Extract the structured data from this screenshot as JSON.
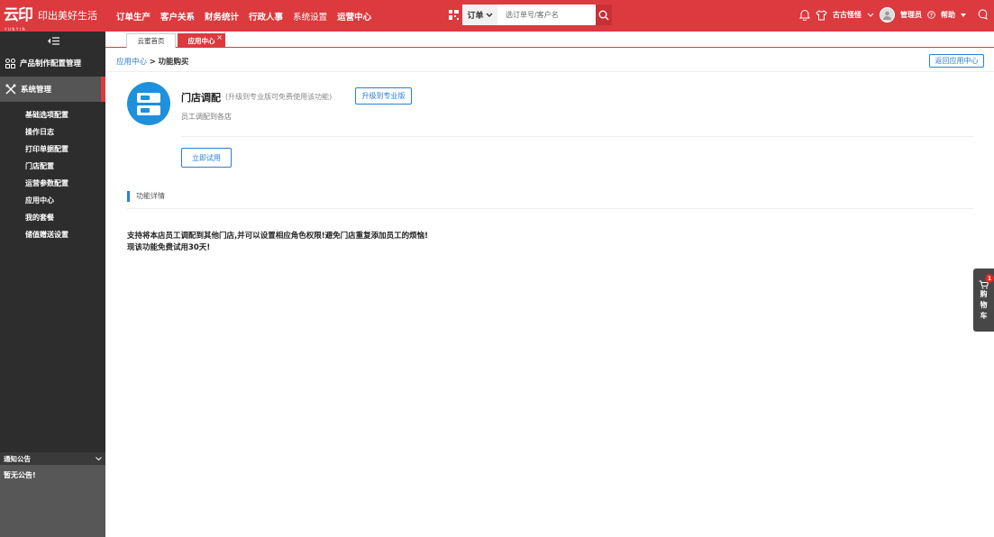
{
  "brand": {
    "logo_text": "云印",
    "logo_sub": "YUNYIN",
    "slogan": "印出美好生活"
  },
  "top_nav": [
    {
      "label": "订单生产"
    },
    {
      "label": "客户关系"
    },
    {
      "label": "财务统计"
    },
    {
      "label": "行政人事"
    },
    {
      "label": "系统设置"
    },
    {
      "label": "运营中心"
    }
  ],
  "search": {
    "type_label": "订单",
    "placeholder": "选订单号/客户名"
  },
  "user": {
    "store_name": "古古怪怪",
    "username": "管理员",
    "help_label": "帮助"
  },
  "sidebar": {
    "groups": [
      {
        "label": "产品制作配置管理"
      },
      {
        "label": "系统管理"
      }
    ],
    "items": [
      {
        "label": "基础选项配置"
      },
      {
        "label": "操作日志"
      },
      {
        "label": "打印单据配置"
      },
      {
        "label": "门店配置"
      },
      {
        "label": "运营参数配置"
      },
      {
        "label": "应用中心"
      },
      {
        "label": "我的套餐"
      },
      {
        "label": "储值赠送设置"
      }
    ],
    "notice": {
      "title": "通知公告",
      "body": "暂无公告!"
    }
  },
  "tabs": [
    {
      "label": "云蜜首页"
    },
    {
      "label": "应用中心"
    }
  ],
  "tab_close": "×",
  "breadcrumb": {
    "parent": "应用中心",
    "separator": ">",
    "current": "功能购买"
  },
  "back_button": "返回应用中心",
  "app": {
    "title": "门店调配",
    "hint": "(升级到专业版可免费使用该功能)",
    "upgrade_button": "升级到专业版",
    "description": "员工调配到各店",
    "trial_button": "立即试用"
  },
  "detail": {
    "heading": "功能详情",
    "line1": "支持将本店员工调配到其他门店,并可以设置相应角色权限!避免门店重复添加员工的烦恼!",
    "line2": "现该功能免费试用30天!"
  },
  "cart": {
    "chars": [
      "购",
      "物",
      "车"
    ],
    "badge": "1"
  },
  "colors": {
    "brand_red": "#dc3a3e",
    "link_blue": "#2b7fd0",
    "icon_blue": "#1e90dc",
    "sidebar_dark": "#2d2d2d"
  }
}
